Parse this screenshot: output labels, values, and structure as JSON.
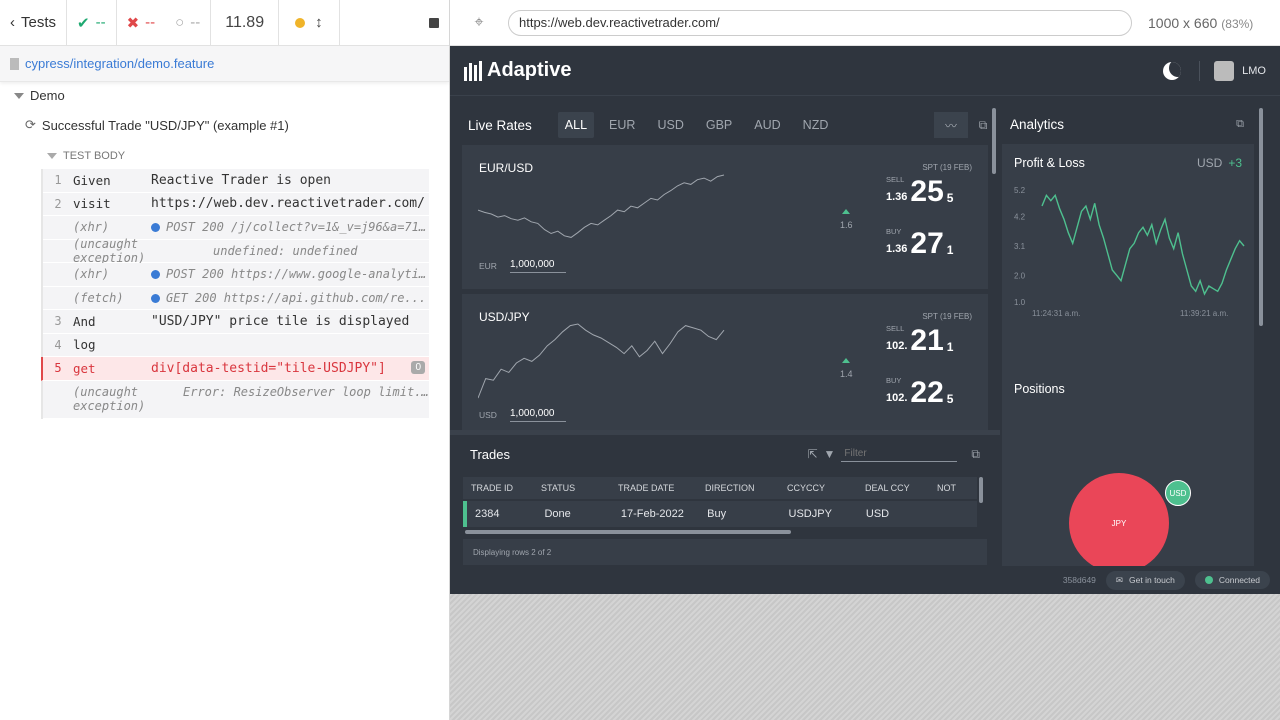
{
  "reporter": {
    "back_label": "Tests",
    "passed": "--",
    "failed": "--",
    "pending": "--",
    "duration": "11.89",
    "spec_path": "cypress/integration/demo.feature",
    "suite_title": "Demo",
    "test_title": "Successful Trade \"USD/JPY\" (example #1)",
    "test_body_label": "TEST BODY",
    "commands": [
      {
        "num": "1",
        "name": "Given",
        "message": "Reactive Trader is open",
        "kind": "step"
      },
      {
        "num": "2",
        "name": "visit",
        "message": "https://web.dev.reactivetrader.com/",
        "kind": "step"
      },
      {
        "num": "",
        "name": "(xhr)",
        "message": "POST 200 /j/collect?v=1&_v=j96&a=7185979...",
        "kind": "sub"
      },
      {
        "num": "",
        "name": "(uncaught exception)",
        "message": "undefined: undefined",
        "kind": "sub"
      },
      {
        "num": "",
        "name": "(xhr)",
        "message": "POST 200 https://www.google-analytics.co...",
        "kind": "sub"
      },
      {
        "num": "",
        "name": "(fetch)",
        "message": "GET 200 https://api.github.com/re...",
        "kind": "sub"
      },
      {
        "num": "3",
        "name": "And",
        "message": "\"USD/JPY\" price tile is displayed",
        "kind": "step"
      },
      {
        "num": "4",
        "name": "log",
        "message": "",
        "kind": "step"
      },
      {
        "num": "5",
        "name": "get",
        "message": "div[data-testid=\"tile-USDJPY\"]",
        "kind": "fail",
        "badge": "0"
      },
      {
        "num": "",
        "name": "(uncaught exception)",
        "message": "Error: ResizeObserver loop limit...",
        "kind": "sub"
      }
    ]
  },
  "browser": {
    "url": "https://web.dev.reactivetrader.com/",
    "viewport": "1000 x 660",
    "zoom": "(83%)"
  },
  "app": {
    "brand": "Adaptive",
    "user": "LMO",
    "live_rates": {
      "title": "Live Rates",
      "currencies": [
        "ALL",
        "EUR",
        "USD",
        "GBP",
        "AUD",
        "NZD"
      ],
      "active": "ALL",
      "tiles": [
        {
          "symbol": "EUR/USD",
          "spot": "SPT (19 FEB)",
          "notional_ccy": "EUR",
          "notional": "1,000,000",
          "movement": "1.6",
          "sell": {
            "label": "SELL",
            "small": "1.36",
            "big": "25",
            "pip": "5"
          },
          "buy": {
            "label": "BUY",
            "small": "1.36",
            "big": "27",
            "pip": "1"
          },
          "history": [
            0.55,
            0.52,
            0.5,
            0.46,
            0.48,
            0.44,
            0.42,
            0.45,
            0.4,
            0.38,
            0.3,
            0.25,
            0.28,
            0.22,
            0.2,
            0.26,
            0.33,
            0.38,
            0.36,
            0.42,
            0.48,
            0.55,
            0.53,
            0.6,
            0.58,
            0.64,
            0.7,
            0.68,
            0.75,
            0.8,
            0.86,
            0.9,
            0.88,
            0.94,
            0.96,
            0.92,
            0.98,
            1.0
          ]
        },
        {
          "symbol": "USD/JPY",
          "spot": "SPT (19 FEB)",
          "notional_ccy": "USD",
          "notional": "1,000,000",
          "movement": "1.4",
          "sell": {
            "label": "SELL",
            "small": "102.",
            "big": "21",
            "pip": "1"
          },
          "buy": {
            "label": "BUY",
            "small": "102.",
            "big": "22",
            "pip": "5"
          },
          "history": [
            0.05,
            0.3,
            0.28,
            0.42,
            0.38,
            0.5,
            0.56,
            0.52,
            0.6,
            0.72,
            0.8,
            0.9,
            0.98,
            1.0,
            0.92,
            0.86,
            0.82,
            0.76,
            0.7,
            0.62,
            0.72,
            0.58,
            0.66,
            0.78,
            0.62,
            0.75,
            0.9,
            0.98,
            0.95,
            0.92,
            0.84,
            0.8,
            0.92
          ]
        }
      ]
    },
    "analytics": {
      "title": "Analytics",
      "pnl_label": "Profit & Loss",
      "pnl_ccy": "USD",
      "pnl_value": "+3",
      "chart_data": {
        "type": "line",
        "title": "",
        "yticks": [
          "5.2",
          "4.2",
          "3.1",
          "2.0",
          "1.0"
        ],
        "xticks": [
          "11:24:31 a.m.",
          "11:39:21 a.m."
        ],
        "ylim": [
          1.0,
          5.2
        ],
        "series": [
          {
            "values": [
              4.6,
              5.0,
              4.8,
              5.0,
              4.5,
              4.1,
              3.6,
              3.2,
              3.8,
              4.4,
              4.6,
              4.1,
              4.7,
              3.9,
              3.4,
              2.8,
              2.2,
              2.0,
              1.8,
              2.4,
              3.0,
              3.2,
              3.6,
              3.8,
              3.5,
              3.9,
              3.2,
              3.7,
              4.1,
              3.4,
              3.0,
              3.6,
              2.8,
              2.2,
              1.6,
              1.4,
              1.8,
              1.3,
              1.6,
              1.5,
              1.4,
              1.7,
              2.2,
              2.6,
              3.0,
              3.3,
              3.1
            ]
          }
        ]
      },
      "positions_label": "Positions",
      "positions": [
        {
          "ccy": "JPY",
          "color": "#ea4658"
        },
        {
          "ccy": "USD",
          "color": "#4ec08f"
        }
      ]
    },
    "trades": {
      "title": "Trades",
      "filter_placeholder": "Filter",
      "columns": [
        "TRADE ID",
        "STATUS",
        "TRADE DATE",
        "DIRECTION",
        "CCYCCY",
        "DEAL CCY",
        "NOT"
      ],
      "rows": [
        [
          "2384",
          "Done",
          "17-Feb-2022",
          "Buy",
          "USDJPY",
          "USD",
          ""
        ]
      ],
      "footer": "Displaying rows 2 of 2"
    },
    "footer": {
      "build": "358d649",
      "contact": "Get in touch",
      "status": "Connected"
    }
  }
}
